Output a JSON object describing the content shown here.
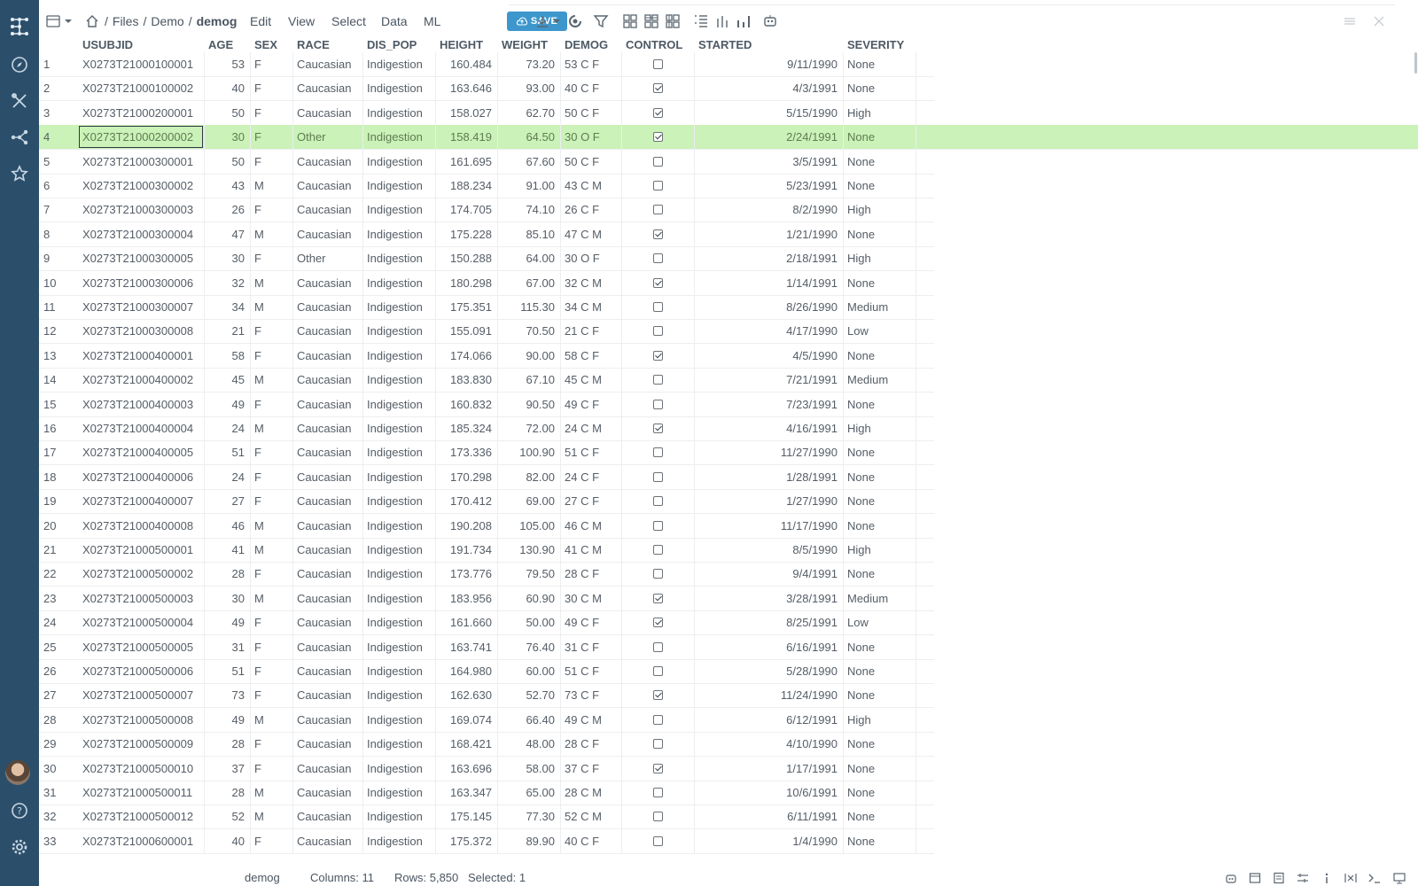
{
  "breadcrumb": {
    "files": "Files",
    "sep1": "/",
    "demo": "Demo",
    "sep2": "/",
    "table": "demog"
  },
  "menu": [
    "Edit",
    "View",
    "Select",
    "Data",
    "ML"
  ],
  "save_label": "SAVE",
  "icons": {
    "sidebar": [
      "grid-logo-icon",
      "compass-icon",
      "tools-icon",
      "network-icon",
      "star-icon",
      "help-icon",
      "settings-icon"
    ],
    "toolbar": [
      "table-view-icon",
      "home-icon",
      "download-icon",
      "refresh-icon",
      "filter-icon",
      "layout-1-icon",
      "layout-2-icon",
      "layout-3-icon",
      "list-icon",
      "bars-1-icon",
      "bars-2-icon",
      "robot-icon",
      "menu-icon",
      "close-icon"
    ]
  },
  "colors": {
    "sidebar": "#2b4f6b",
    "accent": "#3e97cc",
    "selected_row": "#cbf2b8"
  },
  "table": {
    "columns": [
      "USUBJID",
      "AGE",
      "SEX",
      "RACE",
      "DIS_POP",
      "HEIGHT",
      "WEIGHT",
      "DEMOG",
      "CONTROL",
      "STARTED",
      "SEVERITY"
    ],
    "selected_row": 4,
    "rows": [
      [
        "1",
        "X0273T21000100001",
        "53",
        "F",
        "Caucasian",
        "Indigestion",
        "160.484",
        "73.20",
        "53 C F",
        false,
        "9/11/1990",
        "None"
      ],
      [
        "2",
        "X0273T21000100002",
        "40",
        "F",
        "Caucasian",
        "Indigestion",
        "163.646",
        "93.00",
        "40 C F",
        true,
        "4/3/1991",
        "None"
      ],
      [
        "3",
        "X0273T21000200001",
        "50",
        "F",
        "Caucasian",
        "Indigestion",
        "158.027",
        "62.70",
        "50 C F",
        true,
        "5/15/1990",
        "High"
      ],
      [
        "4",
        "X0273T21000200002",
        "30",
        "F",
        "Other",
        "Indigestion",
        "158.419",
        "64.50",
        "30 O F",
        true,
        "2/24/1991",
        "None"
      ],
      [
        "5",
        "X0273T21000300001",
        "50",
        "F",
        "Caucasian",
        "Indigestion",
        "161.695",
        "67.60",
        "50 C F",
        false,
        "3/5/1991",
        "None"
      ],
      [
        "6",
        "X0273T21000300002",
        "43",
        "M",
        "Caucasian",
        "Indigestion",
        "188.234",
        "91.00",
        "43 C M",
        false,
        "5/23/1991",
        "None"
      ],
      [
        "7",
        "X0273T21000300003",
        "26",
        "F",
        "Caucasian",
        "Indigestion",
        "174.705",
        "74.10",
        "26 C F",
        false,
        "8/2/1990",
        "High"
      ],
      [
        "8",
        "X0273T21000300004",
        "47",
        "M",
        "Caucasian",
        "Indigestion",
        "175.228",
        "85.10",
        "47 C M",
        true,
        "1/21/1990",
        "None"
      ],
      [
        "9",
        "X0273T21000300005",
        "30",
        "F",
        "Other",
        "Indigestion",
        "150.288",
        "64.00",
        "30 O F",
        false,
        "2/18/1991",
        "High"
      ],
      [
        "10",
        "X0273T21000300006",
        "32",
        "M",
        "Caucasian",
        "Indigestion",
        "180.298",
        "67.00",
        "32 C M",
        true,
        "1/14/1991",
        "None"
      ],
      [
        "11",
        "X0273T21000300007",
        "34",
        "M",
        "Caucasian",
        "Indigestion",
        "175.351",
        "115.30",
        "34 C M",
        false,
        "8/26/1990",
        "Medium"
      ],
      [
        "12",
        "X0273T21000300008",
        "21",
        "F",
        "Caucasian",
        "Indigestion",
        "155.091",
        "70.50",
        "21 C F",
        false,
        "4/17/1990",
        "Low"
      ],
      [
        "13",
        "X0273T21000400001",
        "58",
        "F",
        "Caucasian",
        "Indigestion",
        "174.066",
        "90.00",
        "58 C F",
        true,
        "4/5/1990",
        "None"
      ],
      [
        "14",
        "X0273T21000400002",
        "45",
        "M",
        "Caucasian",
        "Indigestion",
        "183.830",
        "67.10",
        "45 C M",
        false,
        "7/21/1991",
        "Medium"
      ],
      [
        "15",
        "X0273T21000400003",
        "49",
        "F",
        "Caucasian",
        "Indigestion",
        "160.832",
        "90.50",
        "49 C F",
        false,
        "7/23/1991",
        "None"
      ],
      [
        "16",
        "X0273T21000400004",
        "24",
        "M",
        "Caucasian",
        "Indigestion",
        "185.324",
        "72.00",
        "24 C M",
        true,
        "4/16/1991",
        "High"
      ],
      [
        "17",
        "X0273T21000400005",
        "51",
        "F",
        "Caucasian",
        "Indigestion",
        "173.336",
        "100.90",
        "51 C F",
        false,
        "11/27/1990",
        "None"
      ],
      [
        "18",
        "X0273T21000400006",
        "24",
        "F",
        "Caucasian",
        "Indigestion",
        "170.298",
        "82.00",
        "24 C F",
        false,
        "1/28/1991",
        "None"
      ],
      [
        "19",
        "X0273T21000400007",
        "27",
        "F",
        "Caucasian",
        "Indigestion",
        "170.412",
        "69.00",
        "27 C F",
        false,
        "1/27/1990",
        "None"
      ],
      [
        "20",
        "X0273T21000400008",
        "46",
        "M",
        "Caucasian",
        "Indigestion",
        "190.208",
        "105.00",
        "46 C M",
        false,
        "11/17/1990",
        "None"
      ],
      [
        "21",
        "X0273T21000500001",
        "41",
        "M",
        "Caucasian",
        "Indigestion",
        "191.734",
        "130.90",
        "41 C M",
        false,
        "8/5/1990",
        "High"
      ],
      [
        "22",
        "X0273T21000500002",
        "28",
        "F",
        "Caucasian",
        "Indigestion",
        "173.776",
        "79.50",
        "28 C F",
        false,
        "9/4/1991",
        "None"
      ],
      [
        "23",
        "X0273T21000500003",
        "30",
        "M",
        "Caucasian",
        "Indigestion",
        "183.956",
        "60.90",
        "30 C M",
        true,
        "3/28/1991",
        "Medium"
      ],
      [
        "24",
        "X0273T21000500004",
        "49",
        "F",
        "Caucasian",
        "Indigestion",
        "161.660",
        "50.00",
        "49 C F",
        true,
        "8/25/1991",
        "Low"
      ],
      [
        "25",
        "X0273T21000500005",
        "31",
        "F",
        "Caucasian",
        "Indigestion",
        "163.741",
        "76.40",
        "31 C F",
        false,
        "6/16/1991",
        "None"
      ],
      [
        "26",
        "X0273T21000500006",
        "51",
        "F",
        "Caucasian",
        "Indigestion",
        "164.980",
        "60.00",
        "51 C F",
        false,
        "5/28/1990",
        "None"
      ],
      [
        "27",
        "X0273T21000500007",
        "73",
        "F",
        "Caucasian",
        "Indigestion",
        "162.630",
        "52.70",
        "73 C F",
        true,
        "11/24/1990",
        "None"
      ],
      [
        "28",
        "X0273T21000500008",
        "49",
        "M",
        "Caucasian",
        "Indigestion",
        "169.074",
        "66.40",
        "49 C M",
        false,
        "6/12/1991",
        "High"
      ],
      [
        "29",
        "X0273T21000500009",
        "28",
        "F",
        "Caucasian",
        "Indigestion",
        "168.421",
        "48.00",
        "28 C F",
        false,
        "4/10/1990",
        "None"
      ],
      [
        "30",
        "X0273T21000500010",
        "37",
        "F",
        "Caucasian",
        "Indigestion",
        "163.696",
        "58.00",
        "37 C F",
        true,
        "1/17/1991",
        "None"
      ],
      [
        "31",
        "X0273T21000500011",
        "28",
        "M",
        "Caucasian",
        "Indigestion",
        "163.347",
        "65.00",
        "28 C M",
        false,
        "10/6/1991",
        "None"
      ],
      [
        "32",
        "X0273T21000500012",
        "52",
        "M",
        "Caucasian",
        "Indigestion",
        "175.145",
        "77.30",
        "52 C M",
        false,
        "6/11/1991",
        "None"
      ],
      [
        "33",
        "X0273T21000600001",
        "40",
        "F",
        "Caucasian",
        "Indigestion",
        "175.372",
        "89.90",
        "40 C F",
        false,
        "1/4/1990",
        "None"
      ]
    ]
  },
  "status": {
    "table": "demog",
    "columns": "Columns: 11",
    "rows": "Rows: 5,850",
    "selected": "Selected: 1"
  }
}
